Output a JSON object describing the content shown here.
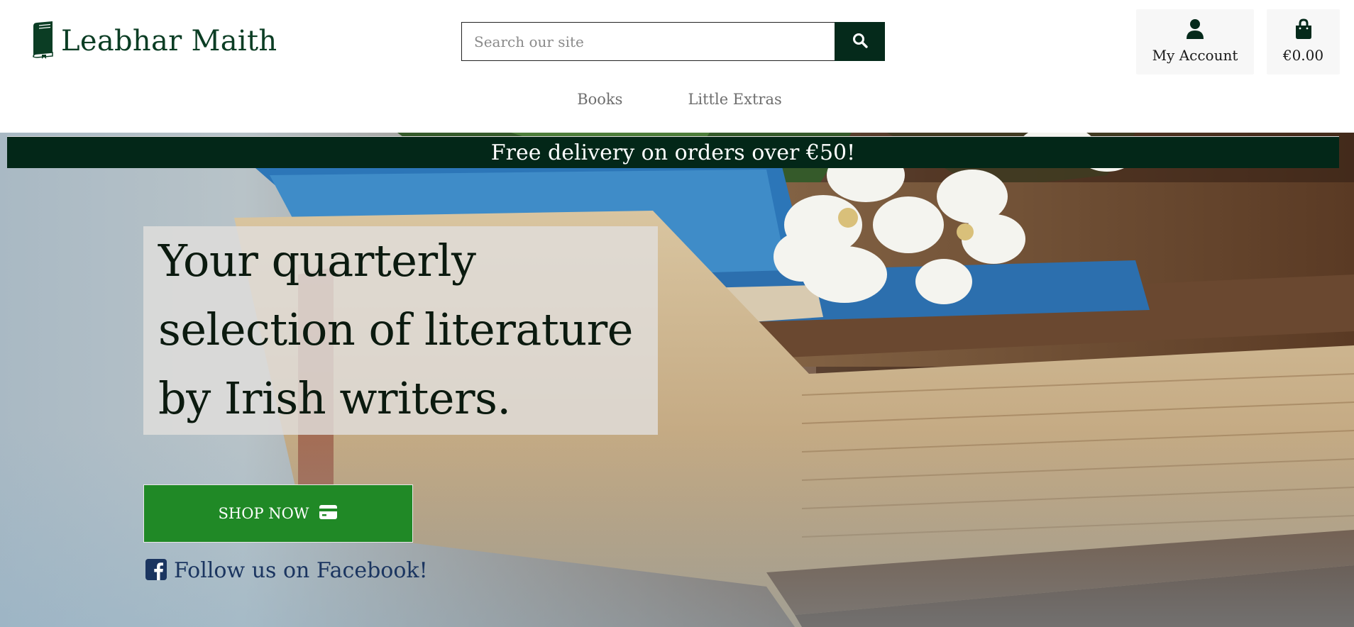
{
  "brand": {
    "name": "Leabhar Maith",
    "color": "#0b3d24"
  },
  "search": {
    "placeholder": "Search our site"
  },
  "account": {
    "label": "My Account"
  },
  "cart": {
    "total": "€0.00"
  },
  "nav": {
    "items": [
      {
        "label": "Books"
      },
      {
        "label": "Little Extras"
      }
    ]
  },
  "banner": {
    "text": "Free delivery on orders over €50!"
  },
  "hero": {
    "headline_lines": [
      "Your quarterly",
      "selection of literature",
      "by Irish writers."
    ],
    "cta_label": "SHOP NOW",
    "facebook_label": "Follow us on Facebook!"
  },
  "icons": {
    "logo": "book-icon",
    "search": "search-icon",
    "account": "user-icon",
    "cart": "shopping-bag-icon",
    "cta": "credit-card-icon",
    "social": "facebook-icon"
  },
  "colors": {
    "dark_green": "#052a1b",
    "cta_green": "#208926",
    "facebook_blue": "#1b3560"
  }
}
